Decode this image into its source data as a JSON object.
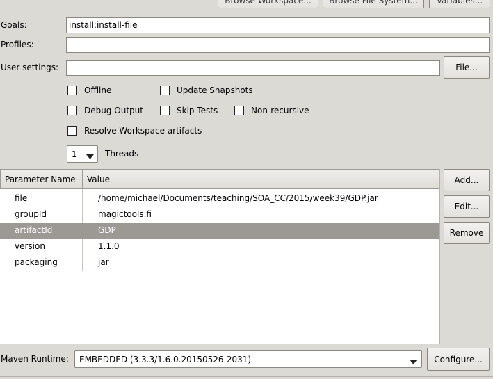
{
  "top_buttons": {
    "browse_workspace": "Browse Workspace...",
    "browse_file_system": "Browse File System...",
    "variables": "Variables..."
  },
  "goals": {
    "label": "Goals:",
    "value": "install:install-file"
  },
  "profiles": {
    "label": "Profiles:",
    "value": ""
  },
  "user_settings": {
    "label": "User settings:",
    "value": "",
    "button": "File..."
  },
  "options": {
    "offline": {
      "label": "Offline",
      "checked": false
    },
    "update_snapshots": {
      "label": "Update Snapshots",
      "checked": false
    },
    "debug_output": {
      "label": "Debug Output",
      "checked": false
    },
    "skip_tests": {
      "label": "Skip Tests",
      "checked": false
    },
    "non_recursive": {
      "label": "Non-recursive",
      "checked": false
    },
    "resolve_workspace": {
      "label": "Resolve Workspace artifacts",
      "checked": false
    }
  },
  "threads": {
    "value": "1",
    "label": "Threads"
  },
  "params_table": {
    "headers": [
      "Parameter Name",
      "Value"
    ],
    "rows": [
      {
        "name": "file",
        "value": "/home/michael/Documents/teaching/SOA_CC/2015/week39/GDP.jar"
      },
      {
        "name": "groupId",
        "value": "magictools.fi"
      },
      {
        "name": "artifactId",
        "value": "GDP"
      },
      {
        "name": "version",
        "value": "1.1.0"
      },
      {
        "name": "packaging",
        "value": "jar"
      }
    ],
    "selected_row": "artifactId"
  },
  "table_buttons": {
    "add": "Add...",
    "edit": "Edit...",
    "remove": "Remove"
  },
  "maven_runtime": {
    "label": "Maven Runtime:",
    "value": "EMBEDDED (3.3.3/1.6.0.20150526-2031)",
    "configure": "Configure..."
  }
}
